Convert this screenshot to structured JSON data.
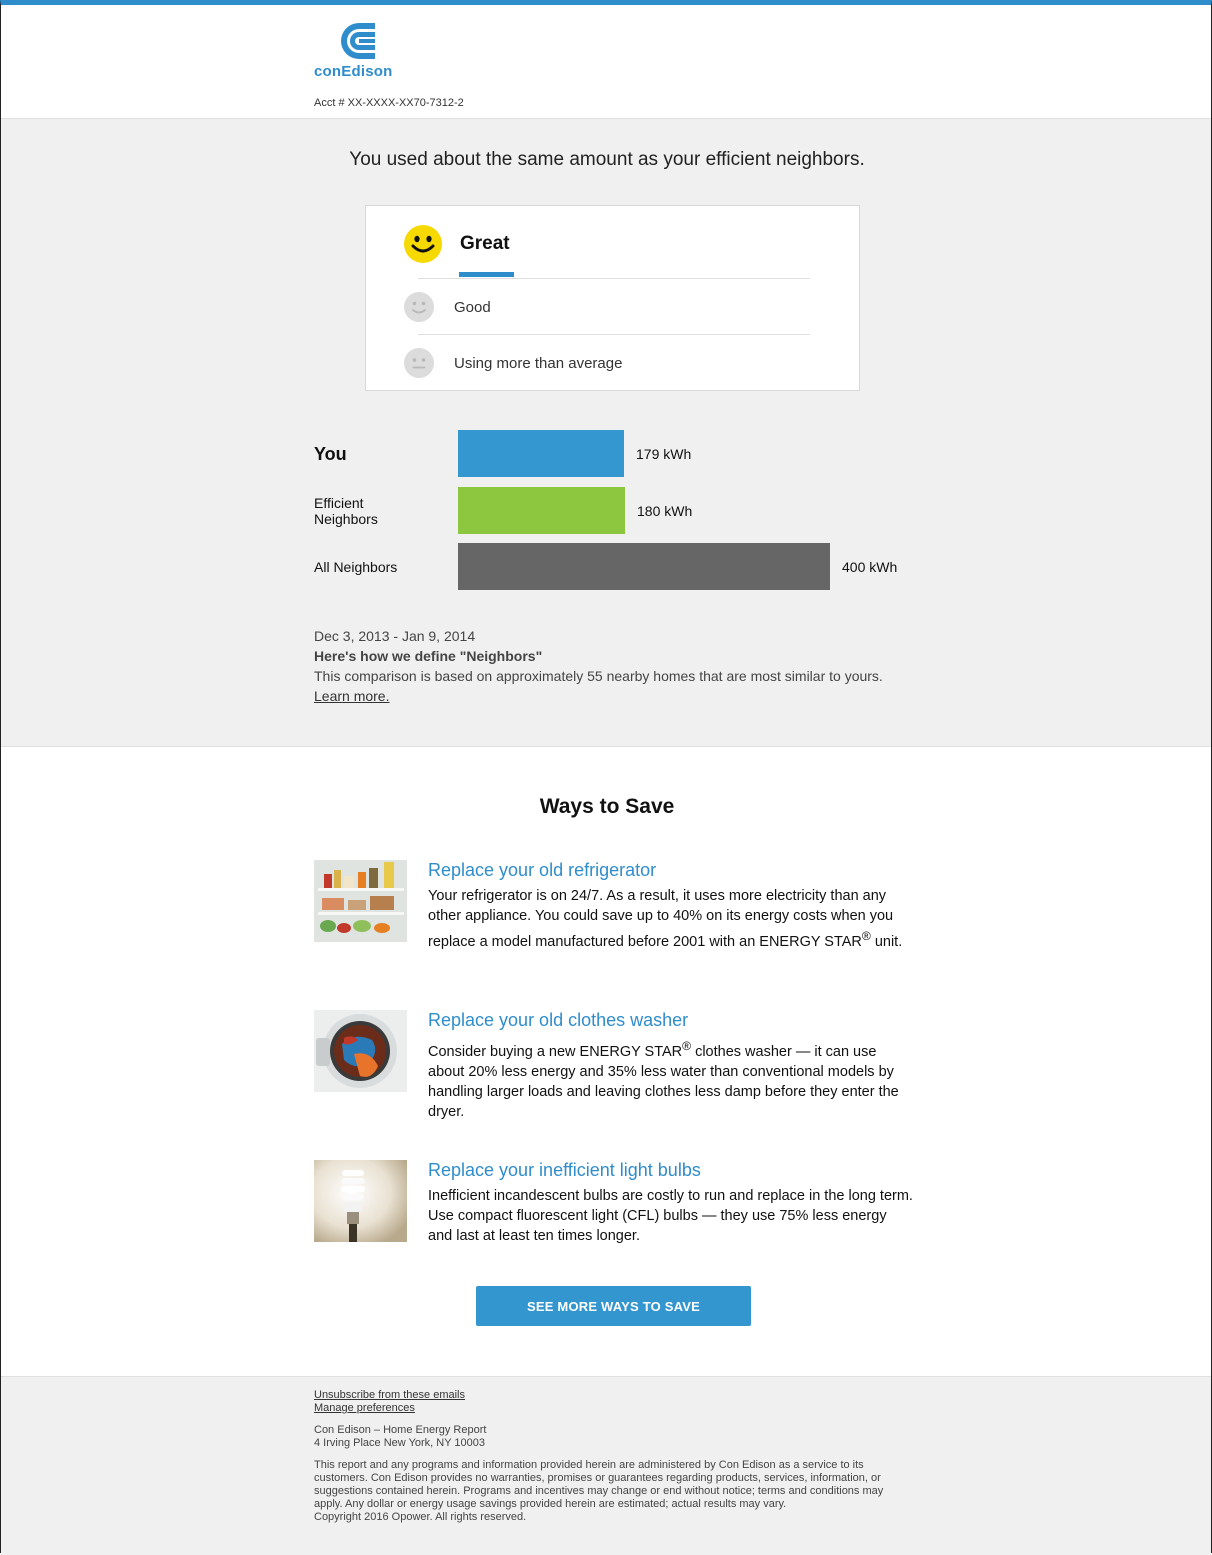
{
  "brand": {
    "name": "conEdison",
    "accent_color": "#2f8dcb",
    "account_number": "Acct # XX-XXXX-XX70-7312-2"
  },
  "comparison": {
    "headline": "You used about the same amount as your efficient neighbors.",
    "ratings": [
      {
        "label": "Great",
        "icon": "happy-face-icon",
        "active": true
      },
      {
        "label": "Good",
        "icon": "smile-face-icon",
        "active": false
      },
      {
        "label": "Using more than average",
        "icon": "neutral-face-icon",
        "active": false
      }
    ],
    "usage_bars": [
      {
        "label": "You",
        "value": 179,
        "display": "179 kWh",
        "color": "#3497cf"
      },
      {
        "label": "Efficient Neighbors",
        "value": 180,
        "display": "180 kWh",
        "color": "#8dc63f"
      },
      {
        "label": "All Neighbors",
        "value": 400,
        "display": "400 kWh",
        "color": "#666666"
      }
    ],
    "date_range": "Dec 3, 2013 - Jan 9, 2014",
    "neighbors_title": "Here's how we define \"Neighbors\"",
    "neighbors_text": "This comparison is based on approximately 55 nearby homes that are most similar to yours.",
    "learn_more": "Learn more."
  },
  "ways_to_save": {
    "title": "Ways to Save",
    "tips": [
      {
        "title": "Replace your old refrigerator",
        "text_before": "Your refrigerator is on 24/7. As a result, it uses more electricity than any other appliance. You could save up to 40% on its energy costs when you replace a model manufactured before 2001 with an ENERGY STAR",
        "text_after": " unit.",
        "icon": "refrigerator-photo"
      },
      {
        "title": "Replace your old clothes washer",
        "text_before": "Consider buying a new ENERGY STAR",
        "text_after": " clothes washer — it can use about 20% less energy and 35% less water than conventional models by handling larger loads and leaving clothes less damp before they enter the dryer.",
        "icon": "washer-photo"
      },
      {
        "title": "Replace your inefficient light bulbs",
        "text_before": "Inefficient incandescent bulbs are costly to run and replace in the long term. Use compact fluorescent light (CFL) bulbs — they use 75% less energy and last at least ten times longer.",
        "text_after": "",
        "icon": "cfl-bulb-photo"
      }
    ],
    "registered_mark": "®",
    "cta_label": "SEE MORE WAYS TO SAVE"
  },
  "footer": {
    "unsubscribe": "Unsubscribe from these emails",
    "manage": "Manage preferences",
    "company": "Con Edison – Home Energy Report",
    "address": "4 Irving Place New York, NY 10003",
    "disclaimer": "This report and any programs and information provided herein are administered by Con Edison as a service to its customers. Con Edison provides no warranties, promises or guarantees regarding products, services, information, or suggestions contained herein. Programs and incentives may change or end without notice; terms and conditions may apply. Any dollar or energy usage savings provided herein are estimated; actual results may vary.",
    "copyright": "Copyright 2016 Opower. All rights reserved."
  }
}
